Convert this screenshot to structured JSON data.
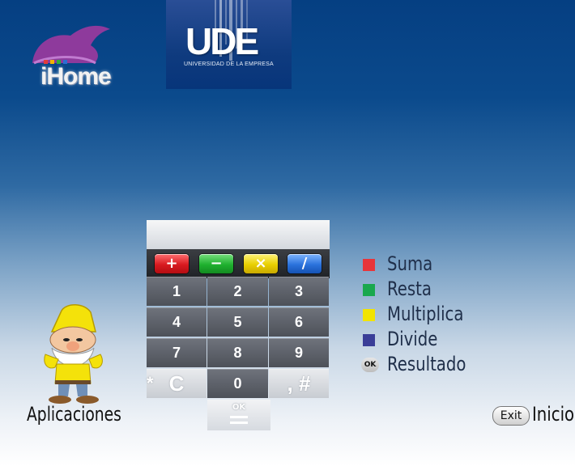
{
  "logos": {
    "ihome": "iHome",
    "ude": "UDE",
    "ude_subtitle": "UNIVERSIDAD DE LA EMPRESA"
  },
  "calculator": {
    "display_value": "",
    "operators": [
      "+",
      "−",
      "×",
      "/"
    ],
    "keys": [
      "1",
      "2",
      "3",
      "4",
      "5",
      "6",
      "7",
      "8",
      "9",
      "C",
      "0",
      ", #"
    ],
    "star": "*",
    "ok": "OK"
  },
  "legend": [
    {
      "label": "Suma",
      "color": "#e8353a"
    },
    {
      "label": "Resta",
      "color": "#19a84d"
    },
    {
      "label": "Multiplica",
      "color": "#f2e400"
    },
    {
      "label": "Divide",
      "color": "#3a3e98"
    },
    {
      "label": "Resultado",
      "chip": "OK"
    }
  ],
  "bottom": {
    "apps_label": "Aplicaciones",
    "exit_label": "Exit",
    "home_label": "Inicio"
  }
}
